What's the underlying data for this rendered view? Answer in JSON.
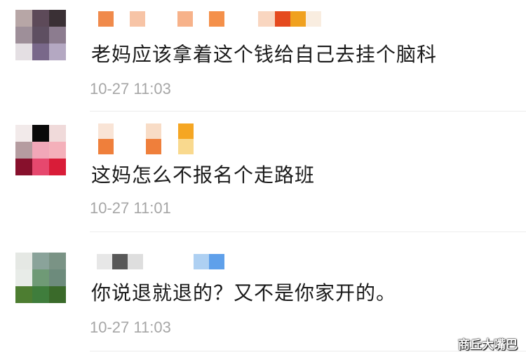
{
  "comments": [
    {
      "text": "老妈应该拿着这个钱给自己去挂个脑科",
      "time": "10-27 11:03",
      "avatar_colors": [
        "#b7a6a6",
        "#5d4a59",
        "#3a3035",
        "#9e8f99",
        "#5e4f61",
        "#8c7c8f",
        "#e4dfe3",
        "#79688a",
        "#b4a8c2"
      ],
      "username_blocks": [
        "#f08a4b",
        "#f7c4a6",
        "#f7b28a",
        "#f4904a",
        "#f9d6c0",
        "#e54a1f",
        "#f0a11f",
        "#f9ede0"
      ]
    },
    {
      "text": "这妈怎么不报名个走路班",
      "time": "10-27 11:01",
      "avatar_colors": [
        "#f2eaea",
        "#0a0a0a",
        "#f0dada",
        "#b59ca0",
        "#f1a7b8",
        "#f4b0ba",
        "#87102c",
        "#e6486e",
        "#d91c38"
      ],
      "username_blocks": [
        "#f9e4d6",
        "#ef7f3b",
        "#f8dcc6",
        "#ef7f3b",
        "#f5a623",
        "#f9d98e"
      ]
    },
    {
      "text": "你说退就退的？又不是你家开的。",
      "time": "10-27 11:03",
      "avatar_colors": [
        "#e5e8e4",
        "#8aa39a",
        "#7a9385",
        "#e8ece8",
        "#6f9a76",
        "#6d8b7c",
        "#4d7d31",
        "#3f7d3c",
        "#3a6a2a"
      ],
      "username_blocks": [
        "#e7e7e7",
        "#585858",
        "#dedede",
        "#aed0f2",
        "#5fa0ea"
      ]
    }
  ],
  "watermark": "商丘大嘴巴"
}
